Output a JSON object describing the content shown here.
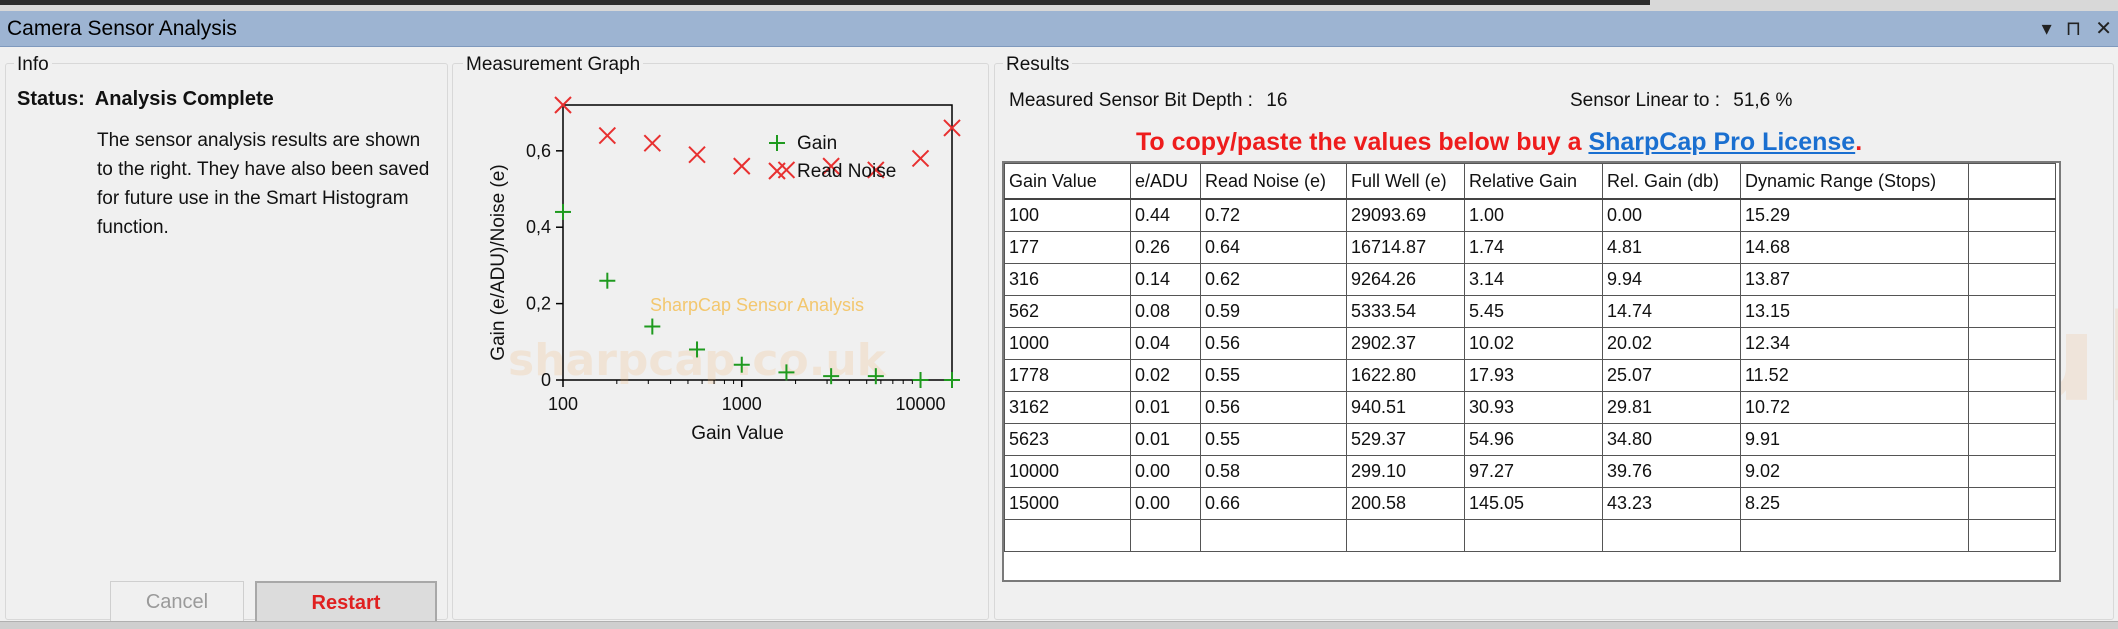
{
  "window": {
    "title": "Camera Sensor Analysis",
    "buttons": [
      "▾",
      "⊓",
      "✕"
    ]
  },
  "info": {
    "group_label": "Info",
    "status_label": "Status:",
    "status_value": "Analysis Complete",
    "description": "The sensor analysis results are shown to the right. They have also been saved for future use in the Smart Histogram function.",
    "cancel_label": "Cancel",
    "restart_label": "Restart"
  },
  "graph": {
    "group_label": "Measurement Graph",
    "watermark": "SharpCap Sensor Analysis",
    "watermark_url": "sharpcap.co.uk"
  },
  "chart_data": {
    "type": "scatter",
    "xscale": "log",
    "xlim": [
      100,
      15000
    ],
    "ylim": [
      0,
      0.72
    ],
    "xlabel": "Gain Value",
    "ylabel": "Gain (e/ADU)/Noise (e)",
    "xticks": [
      "100",
      "1000",
      "10000"
    ],
    "yticks": [
      "0",
      "0,2",
      "0,4",
      "0,6"
    ],
    "legend_position": "top-right",
    "x": [
      100,
      177,
      316,
      562,
      1000,
      1778,
      3162,
      5623,
      10000,
      15000
    ],
    "series": [
      {
        "name": "Gain",
        "marker": "+",
        "color": "#1f9a1f",
        "values": [
          0.44,
          0.26,
          0.14,
          0.08,
          0.04,
          0.02,
          0.01,
          0.01,
          0.0,
          0.0
        ]
      },
      {
        "name": "Read Noise",
        "marker": "x",
        "color": "#e83030",
        "values": [
          0.72,
          0.64,
          0.62,
          0.59,
          0.56,
          0.55,
          0.56,
          0.55,
          0.58,
          0.66
        ]
      }
    ]
  },
  "results": {
    "group_label": "Results",
    "bit_depth_label": "Measured Sensor Bit Depth :",
    "bit_depth_value": "16",
    "linear_label": "Sensor Linear to :",
    "linear_value": "51,6 %",
    "promo_text": "To copy/paste the values below buy a ",
    "promo_link": "SharpCap Pro License",
    "promo_end": ".",
    "watermark_url": "sharpcap.co.uk",
    "columns": [
      "Gain Value",
      "e/ADU",
      "Read Noise (e)",
      "Full Well (e)",
      "Relative Gain",
      "Rel. Gain (db)",
      "Dynamic Range (Stops)",
      ""
    ],
    "rows": [
      [
        "100",
        "0.44",
        "0.72",
        "29093.69",
        "1.00",
        "0.00",
        "15.29",
        ""
      ],
      [
        "177",
        "0.26",
        "0.64",
        "16714.87",
        "1.74",
        "4.81",
        "14.68",
        ""
      ],
      [
        "316",
        "0.14",
        "0.62",
        "9264.26",
        "3.14",
        "9.94",
        "13.87",
        ""
      ],
      [
        "562",
        "0.08",
        "0.59",
        "5333.54",
        "5.45",
        "14.74",
        "13.15",
        ""
      ],
      [
        "1000",
        "0.04",
        "0.56",
        "2902.37",
        "10.02",
        "20.02",
        "12.34",
        ""
      ],
      [
        "1778",
        "0.02",
        "0.55",
        "1622.80",
        "17.93",
        "25.07",
        "11.52",
        ""
      ],
      [
        "3162",
        "0.01",
        "0.56",
        "940.51",
        "30.93",
        "29.81",
        "10.72",
        ""
      ],
      [
        "5623",
        "0.01",
        "0.55",
        "529.37",
        "54.96",
        "34.80",
        "9.91",
        ""
      ],
      [
        "10000",
        "0.00",
        "0.58",
        "299.10",
        "97.27",
        "39.76",
        "9.02",
        ""
      ],
      [
        "15000",
        "0.00",
        "0.66",
        "200.58",
        "145.05",
        "43.23",
        "8.25",
        ""
      ],
      [
        "",
        "",
        "",
        "",
        "",
        "",
        "",
        ""
      ]
    ]
  }
}
